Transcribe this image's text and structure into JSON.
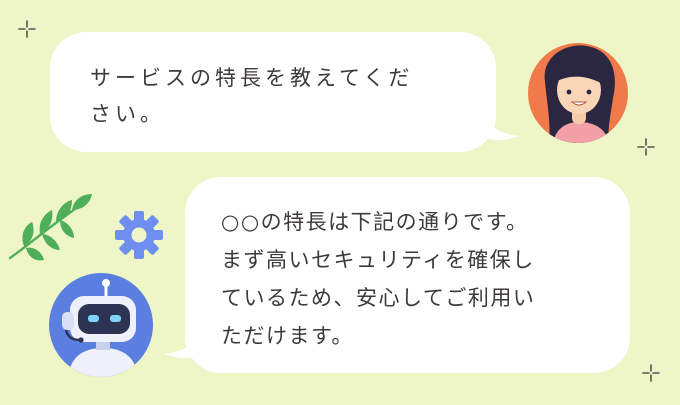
{
  "conversation": {
    "user_message": {
      "lines": [
        "サービスの特長を教えてくだ",
        "さい。"
      ]
    },
    "bot_message": {
      "lines": [
        "○○の特長は下記の通りです。",
        "まず高いセキュリティを確保し",
        "ているため、安心してご利用い",
        "ただけます。"
      ]
    }
  },
  "colors": {
    "background": "#eef6c8",
    "bubble": "#ffffff",
    "text": "#3e3a39",
    "user_avatar_bg": "#f07a4a",
    "bot_avatar_bg": "#5a7fe0",
    "gear": "#6e8ef0",
    "leaf": "#4fae5a"
  },
  "icons": {
    "user_avatar": "woman-avatar-icon",
    "bot_avatar": "robot-avatar-icon",
    "gear": "gear-icon",
    "leaf": "leaf-branch-icon",
    "sparkle": "sparkle-icon"
  }
}
